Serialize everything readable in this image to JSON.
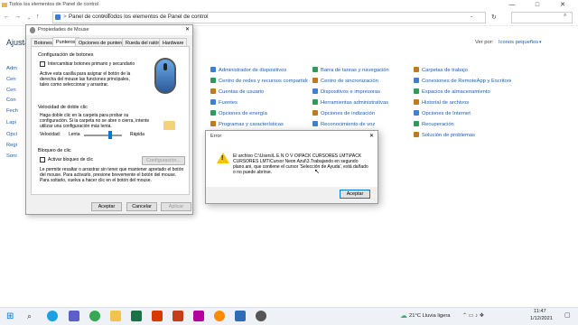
{
  "window": {
    "title": "Todos los elementos de Panel de control"
  },
  "address": {
    "crumbs": [
      "Panel de control",
      "Todos los elementos de Panel de control"
    ],
    "sep": ">"
  },
  "control_panel": {
    "title": "Ajusta",
    "view_by_label": "Ver por:",
    "view_by_value": "Iconos pequeños",
    "left_items": [
      "Adm",
      "Cen",
      "Cen",
      "Con",
      "Fech",
      "Lapi",
      "Opci",
      "Regi",
      "Soni"
    ],
    "columns": [
      [
        "Administrador de dispositivos",
        "Centro de redes y recursos compartidos",
        "Cuentas de usuario",
        "Fuentes",
        "Opciones de energía",
        "Programas y características"
      ],
      [
        "Barra de tareas y navegación",
        "Centro de sincronización",
        "Dispositivos e impresoras",
        "Herramientas administrativas",
        "Opciones de indización",
        "Reconocimiento de voz"
      ],
      [
        "Carpetas de trabajo",
        "Conexiones de RemoteApp y Escritorio",
        "Espacios de almacenamiento",
        "Historial de archivos",
        "Opciones de Internet",
        "Recuperación",
        "Solución de problemas"
      ]
    ],
    "colors": {
      "accent": "#1a5fb4",
      "title": "#1e3a66"
    }
  },
  "mouse_dialog": {
    "title": "Propiedades de Mouse",
    "tabs": [
      "Botones",
      "Punteros",
      "Opciones de puntero",
      "Rueda del ratón",
      "Hardware"
    ],
    "buttons_group": "Configuración de botones",
    "swap_label": "Intercambiar botones primario y secundario",
    "swap_desc": "Active esta casilla para asignar el botón de la derecha del mouse las funciones principales, tales como seleccionar y arrastrar.",
    "dbl_group": "Velocidad de doble clic",
    "dbl_desc": "Haga doble clic en la carpeta para probar su configuración. Si la carpeta no se abre o cierra, intente utilizar una configuración más lenta.",
    "speed_label": "Velocidad:",
    "slow": "Lenta",
    "fast": "Rápida",
    "speed_level": 0.7,
    "lock_group": "Bloqueo de clic",
    "lock_label": "Activar bloqueo de clic",
    "config_btn": "Configuración...",
    "lock_desc": "Le permite resaltar o arrastrar sin tener que mantener apretado el botón del mouse. Para activarlo, presione brevemente el botón del mouse. Para soltarlo, vuelva a hacer clic en el botón del mouse.",
    "ok": "Aceptar",
    "cancel": "Cancelar",
    "apply": "Aplicar"
  },
  "error_dialog": {
    "title": "Error",
    "message": "El archivo C:\\Users\\L E N O V O\\PACK CURSORES LMT\\PACK CURSORES LMT\\Cursor Neon Azul\\3.Trabajando en segundo plano.ani, que contiene el cursor 'Selección de Ayuda', está dañado o no puede abrirse.",
    "ok": "Aceptar",
    "warn_color": "#f5c400"
  },
  "taskbar": {
    "weather": "21°C  Lluvia ligera",
    "time": "11:47",
    "date": "1/12/2021"
  }
}
